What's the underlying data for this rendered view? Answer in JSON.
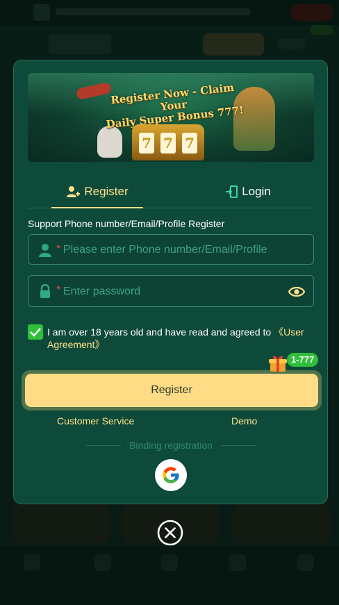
{
  "banner": {
    "headline_line1": "Register Now - Claim Your",
    "headline_line2": "Daily Super Bonus 777!",
    "reels": [
      "7",
      "7",
      "7"
    ]
  },
  "tabs": [
    {
      "label": "Register",
      "icon": "person-add-icon",
      "active": true
    },
    {
      "label": "Login",
      "icon": "login-door-icon",
      "active": false
    }
  ],
  "form": {
    "support_label": "Support Phone number/Email/Profile Register",
    "phone": {
      "required_mark": "*",
      "placeholder": "Please enter Phone number/Email/Profile",
      "value": ""
    },
    "password": {
      "required_mark": "*",
      "placeholder": "Enter password",
      "value": ""
    },
    "agreement": {
      "checked": true,
      "text": "I am over 18 years old and have read and agreed to ",
      "link": "《User Agreement》"
    }
  },
  "promo": {
    "badge": "1-777",
    "icon": "gift-icon"
  },
  "register_button": "Register",
  "links": {
    "customer_service": "Customer Service",
    "demo": "Demo"
  },
  "binding": {
    "label": "Binding registration",
    "providers": [
      "google"
    ]
  },
  "colors": {
    "modal_bg": "#0e4a3a",
    "accent_gold": "#ffe08a",
    "button_gold": "#ffdc85",
    "check_green": "#2fbf3a",
    "required_red": "#e04a4a"
  }
}
